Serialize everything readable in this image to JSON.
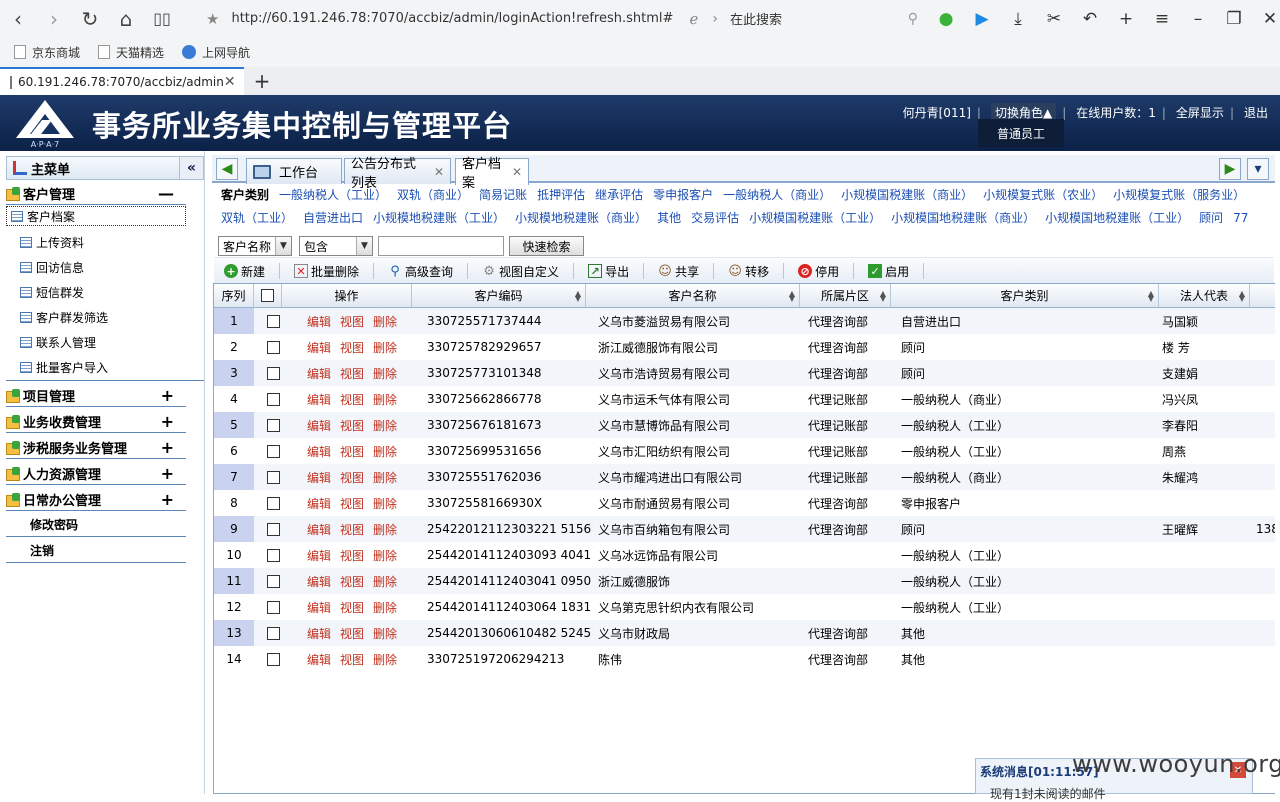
{
  "browser": {
    "url": "http://60.191.246.78:7070/accbiz/admin/loginAction!refresh.shtml#",
    "search_placeholder": "在此搜索",
    "bookmarks": [
      "京东商城",
      "天猫精选",
      "上网导航"
    ],
    "tab_title": "60.191.246.78:7070/accbiz/admin",
    "icons": [
      "back-icon",
      "forward-icon",
      "refresh-icon",
      "home-icon",
      "reader-icon",
      "star-icon",
      "ie-icon",
      "search-icon",
      "wechat-icon",
      "video-icon",
      "download-icon",
      "cut-icon",
      "undo-icon",
      "plus-icon",
      "menu-icon",
      "minimize-icon",
      "restore-icon",
      "close-icon"
    ]
  },
  "header": {
    "logo_text": "A·P·A·7",
    "system_title": "事务所业务集中控制与管理平台",
    "user": "何丹青[011]",
    "switch_role": "切换角色▲",
    "online": "在线用户数：1",
    "fullscreen": "全屏显示",
    "logout": "退出",
    "role_option": "普通员工"
  },
  "sidebar": {
    "main_menu": "主菜单",
    "collapse": "«",
    "groups": [
      {
        "label": "客户管理",
        "toggle": "—",
        "expanded": true,
        "items": [
          "客户档案",
          "上传资料",
          "回访信息",
          "短信群发",
          "客户群发筛选",
          "联系人管理",
          "批量客户导入"
        ]
      },
      {
        "label": "项目管理",
        "toggle": "+"
      },
      {
        "label": "业务收费管理",
        "toggle": "+"
      },
      {
        "label": "涉税服务业务管理",
        "toggle": "+"
      },
      {
        "label": "人力资源管理",
        "toggle": "+"
      },
      {
        "label": "日常办公管理",
        "toggle": "+"
      }
    ],
    "links": [
      "修改密码",
      "注销"
    ]
  },
  "content_tabs": [
    {
      "label": "工作台",
      "closable": false
    },
    {
      "label": "公告分布式列表",
      "closable": true
    },
    {
      "label": "客户档案",
      "closable": true,
      "active": true
    }
  ],
  "categories": {
    "label": "客户类别",
    "row1": [
      "一般纳税人（工业）",
      "双轨（商业）",
      "简易记账",
      "抵押评估",
      "继承评估",
      "零申报客户",
      "一般纳税人（商业）",
      "小规模国税建账（商业）",
      "小规模复式账（农业）",
      "小规模复式账（服务业）"
    ],
    "row2": [
      "双轨（工业）",
      "自营进出口",
      "小规模地税建账（工业）",
      "小规模地税建账（商业）",
      "其他",
      "交易评估",
      "小规模国税建账（工业）",
      "小规模国地税建账（商业）",
      "小规模国地税建账（工业）",
      "顾问",
      "77"
    ]
  },
  "search": {
    "field": "客户名称",
    "operator": "包含",
    "value": "",
    "button": "快速检索"
  },
  "toolbar": [
    "新建",
    "批量删除",
    "高级查询",
    "视图自定义",
    "导出",
    "共享",
    "转移",
    "停用",
    "启用"
  ],
  "grid": {
    "columns": [
      "序列",
      "",
      "操作",
      "客户编码",
      "客户名称",
      "所属片区",
      "客户类别",
      "法人代表"
    ],
    "ops": [
      "编辑",
      "视图",
      "删除"
    ],
    "rows": [
      {
        "no": "1",
        "code": "330725571737444",
        "name": "义乌市菱溢贸易有限公司",
        "area": "代理咨询部",
        "type": "自营进出口",
        "rep": "马国颖",
        "extra": ""
      },
      {
        "no": "2",
        "code": "330725782929657",
        "name": "浙江威德服饰有限公司",
        "area": "代理咨询部",
        "type": "顾问",
        "rep": "楼 芳",
        "extra": ""
      },
      {
        "no": "3",
        "code": "330725773101348",
        "name": "义乌市浩诗贸易有限公司",
        "area": "代理咨询部",
        "type": "顾问",
        "rep": "支建娟",
        "extra": ""
      },
      {
        "no": "4",
        "code": "330725662866778",
        "name": "义乌市运禾气体有限公司",
        "area": "代理记账部",
        "type": "一般纳税人（商业）",
        "rep": "冯兴凤",
        "extra": ""
      },
      {
        "no": "5",
        "code": "330725676181673",
        "name": "义乌市慧博饰品有限公司",
        "area": "代理记账部",
        "type": "一般纳税人（工业）",
        "rep": "李春阳",
        "extra": ""
      },
      {
        "no": "6",
        "code": "330725699531656",
        "name": "义乌市汇阳纺织有限公司",
        "area": "代理记账部",
        "type": "一般纳税人（工业）",
        "rep": "周燕",
        "extra": ""
      },
      {
        "no": "7",
        "code": "330725551762036",
        "name": "义乌市耀鸿进出口有限公司",
        "area": "代理记账部",
        "type": "一般纳税人（商业）",
        "rep": "朱耀鸿",
        "extra": ""
      },
      {
        "no": "8",
        "code": "33072558166930X",
        "name": "义乌市耐通贸易有限公司",
        "area": "代理咨询部",
        "type": "零申报客户",
        "rep": "",
        "extra": ""
      },
      {
        "no": "9",
        "code": "25422012112303221 5156",
        "name": "义乌市百纳箱包有限公司",
        "area": "代理咨询部",
        "type": "顾问",
        "rep": "王曜辉",
        "extra": "138"
      },
      {
        "no": "10",
        "code": "25442014112403093 4041",
        "name": "义乌冰远饰品有限公司",
        "area": "",
        "type": "一般纳税人（工业）",
        "rep": "",
        "extra": ""
      },
      {
        "no": "11",
        "code": "25442014112403041 0950",
        "name": "浙江威德服饰",
        "area": "",
        "type": "一般纳税人（工业）",
        "rep": "",
        "extra": ""
      },
      {
        "no": "12",
        "code": "25442014112403064 1831",
        "name": "义乌第克思针织内衣有限公司",
        "area": "",
        "type": "一般纳税人（工业）",
        "rep": "",
        "extra": ""
      },
      {
        "no": "13",
        "code": "25442013060610482 5245",
        "name": "义乌市财政局",
        "area": "代理咨询部",
        "type": "其他",
        "rep": "",
        "extra": ""
      },
      {
        "no": "14",
        "code": "330725197206294213",
        "name": "陈伟",
        "area": "代理咨询部",
        "type": "其他",
        "rep": "",
        "extra": ""
      }
    ]
  },
  "notification": {
    "title": "系统消息[01:11:57]",
    "body": "现有1封未阅读的邮件"
  },
  "watermark": "www.wooyun.org"
}
